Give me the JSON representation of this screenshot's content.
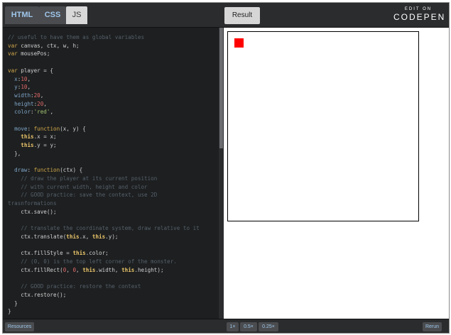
{
  "tabs": {
    "html": "HTML",
    "css": "CSS",
    "js": "JS"
  },
  "result_tab": "Result",
  "codepen": {
    "edit": "EDIT ON",
    "name": "CODEPEN"
  },
  "code_lines": [
    "// useful to have them as global variables",
    "var canvas, ctx, w, h;",
    "var mousePos;",
    "",
    "var player = {",
    "  x:10,",
    "  y:10,",
    "  width:20,",
    "  height:20,",
    "  color:'red',",
    "",
    "  move: function(x, y) {",
    "    this.x = x;",
    "    this.y = y;",
    "  },",
    "",
    "  draw: function(ctx) {",
    "    // draw the player at its current position",
    "    // with current width, height and color",
    "    // GOOD practice: save the context, use 2D",
    "trasnformations",
    "    ctx.save();",
    "",
    "    // translate the coordinate system, draw relative to it",
    "    ctx.translate(this.x, this.y);",
    "",
    "    ctx.fillStyle = this.color;",
    "    // (0, 0) is the top left corner of the monster.",
    "    ctx.fillRect(0, 0, this.width, this.height);",
    "",
    "    // GOOD practice: restore the context",
    "    ctx.restore();",
    "  }",
    "}"
  ],
  "bottom": {
    "resources": "Resources",
    "zoom_1x": "1×",
    "zoom_05x": "0.5×",
    "zoom_025x": "0.25×",
    "rerun": "Rerun"
  },
  "colors": {
    "player": "#ff0000",
    "editor_bg": "#1d1f20",
    "tab_text": "#9fc6ea"
  }
}
